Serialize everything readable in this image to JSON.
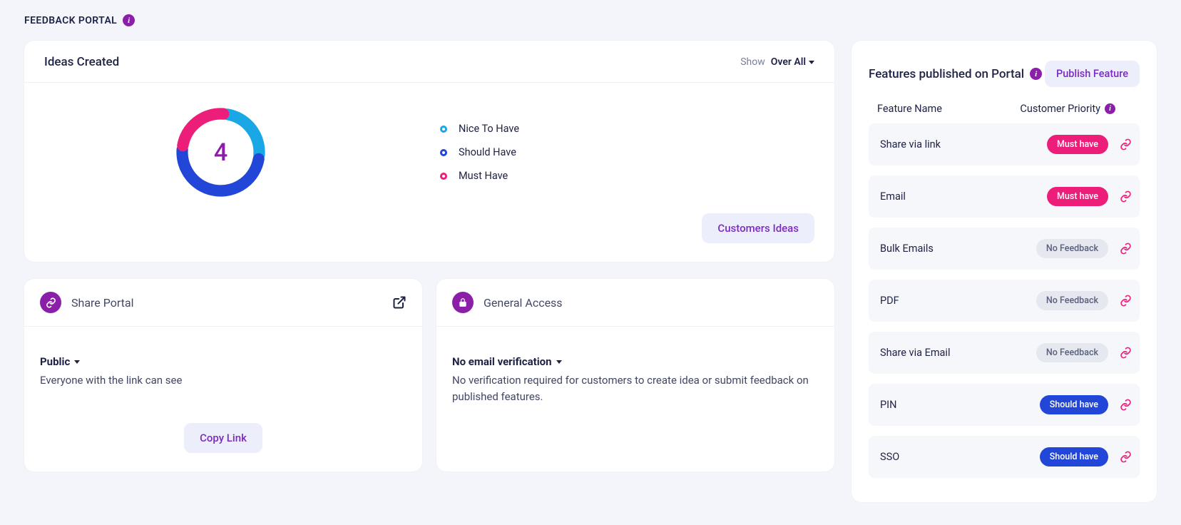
{
  "page": {
    "title": "FEEDBACK PORTAL"
  },
  "ideas": {
    "title": "Ideas Created",
    "show_label": "Show",
    "show_value": "Over All",
    "total": "4",
    "legend": [
      {
        "label": "Nice To Have",
        "color": "#19a7e6"
      },
      {
        "label": "Should Have",
        "color": "#2246d8"
      },
      {
        "label": "Must Have",
        "color": "#ed1e79"
      }
    ],
    "cta": "Customers Ideas"
  },
  "chart_data": {
    "type": "pie",
    "title": "Ideas Created",
    "total": 4,
    "series": [
      {
        "name": "Nice To Have",
        "value": 1,
        "color": "#19a7e6"
      },
      {
        "name": "Should Have",
        "value": 2,
        "color": "#2246d8"
      },
      {
        "name": "Must Have",
        "value": 1,
        "color": "#ed1e79"
      }
    ]
  },
  "share_portal": {
    "title": "Share Portal",
    "visibility_label": "Public",
    "visibility_desc": "Everyone with the link can see",
    "copy_label": "Copy Link"
  },
  "general_access": {
    "title": "General Access",
    "mode_label": "No email verification",
    "mode_desc": "No verification required for customers to create idea or submit feedback on published features."
  },
  "features": {
    "title": "Features published on Portal",
    "publish_label": "Publish Feature",
    "col_name": "Feature Name",
    "col_priority": "Customer Priority",
    "rows": [
      {
        "name": "Share via link",
        "priority": "Must have",
        "kind": "must"
      },
      {
        "name": "Email",
        "priority": "Must have",
        "kind": "must"
      },
      {
        "name": "Bulk Emails",
        "priority": "No Feedback",
        "kind": "none"
      },
      {
        "name": "PDF",
        "priority": "No Feedback",
        "kind": "none"
      },
      {
        "name": "Share via Email",
        "priority": "No Feedback",
        "kind": "none"
      },
      {
        "name": "PIN",
        "priority": "Should have",
        "kind": "should"
      },
      {
        "name": "SSO",
        "priority": "Should have",
        "kind": "should"
      }
    ]
  }
}
